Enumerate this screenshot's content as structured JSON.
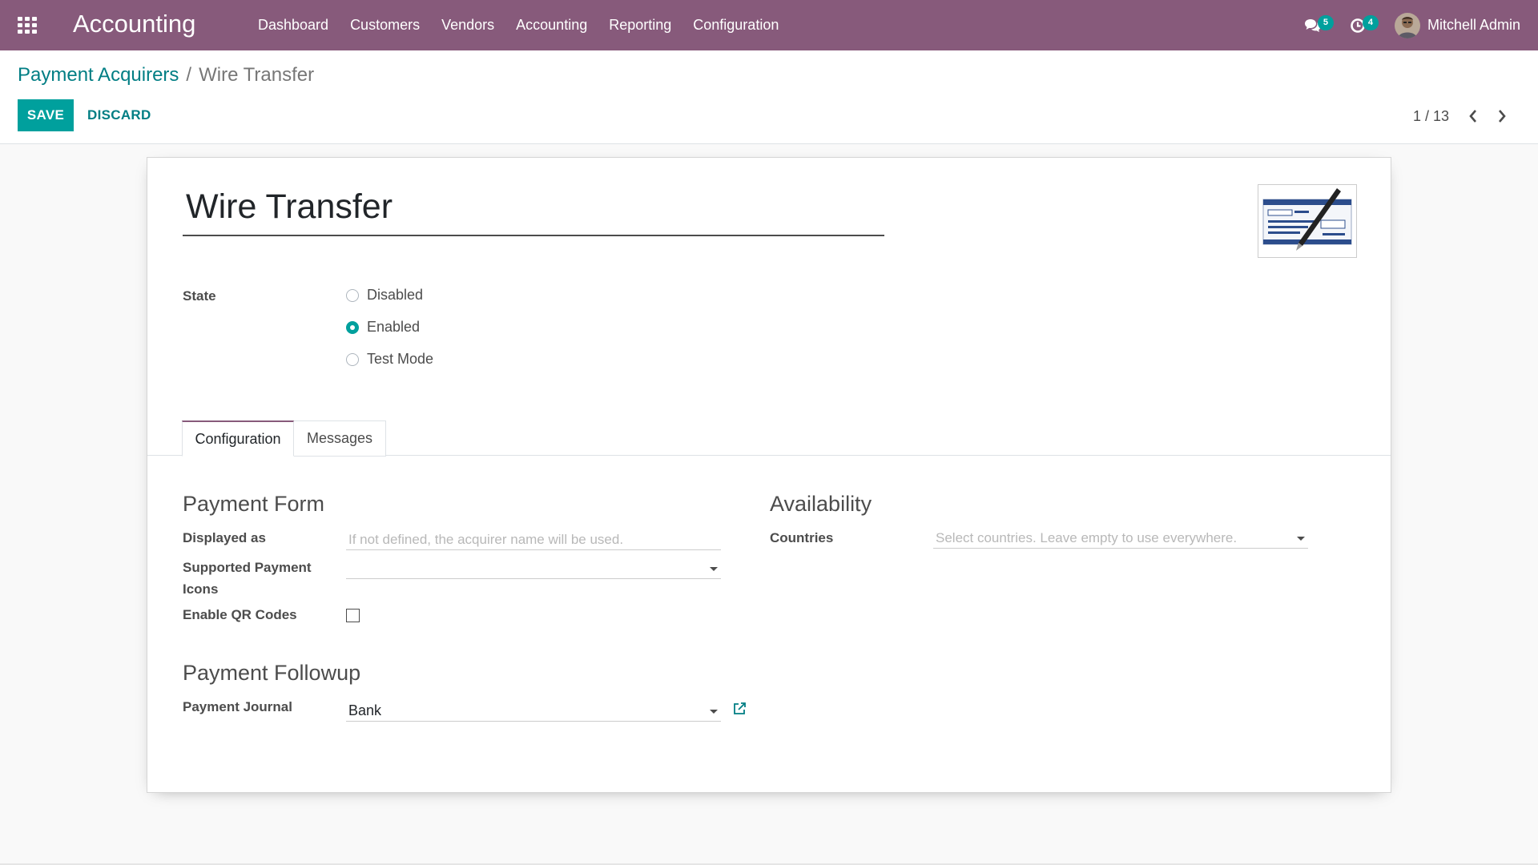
{
  "navbar": {
    "app_name": "Accounting",
    "menu": [
      "Dashboard",
      "Customers",
      "Vendors",
      "Accounting",
      "Reporting",
      "Configuration"
    ],
    "messages_count": "5",
    "activities_count": "4",
    "user_name": "Mitchell Admin"
  },
  "breadcrumb": {
    "parent": "Payment Acquirers",
    "separator": "/",
    "current": "Wire Transfer"
  },
  "actions": {
    "save_label": "SAVE",
    "discard_label": "DISCARD"
  },
  "pager": {
    "text": "1 / 13"
  },
  "form": {
    "title": "Wire Transfer",
    "state_label": "State",
    "state_options": [
      "Disabled",
      "Enabled",
      "Test Mode"
    ],
    "state_selected": "Enabled",
    "tabs": [
      "Configuration",
      "Messages"
    ],
    "active_tab": "Configuration",
    "payment_form": {
      "title": "Payment Form",
      "displayed_as_label": "Displayed as",
      "displayed_as_placeholder": "If not defined, the acquirer name will be used.",
      "payment_icons_label_1": "Supported Payment",
      "payment_icons_label_2": "Icons",
      "qr_codes_label": "Enable QR Codes",
      "qr_codes_checked": false
    },
    "availability": {
      "title": "Availability",
      "countries_label": "Countries",
      "countries_placeholder": "Select countries. Leave empty to use everywhere."
    },
    "payment_followup": {
      "title": "Payment Followup",
      "journal_label": "Payment Journal",
      "journal_value": "Bank"
    }
  },
  "colors": {
    "navbar": "#875a7b",
    "primary": "#00a09d",
    "link": "#017e84"
  }
}
